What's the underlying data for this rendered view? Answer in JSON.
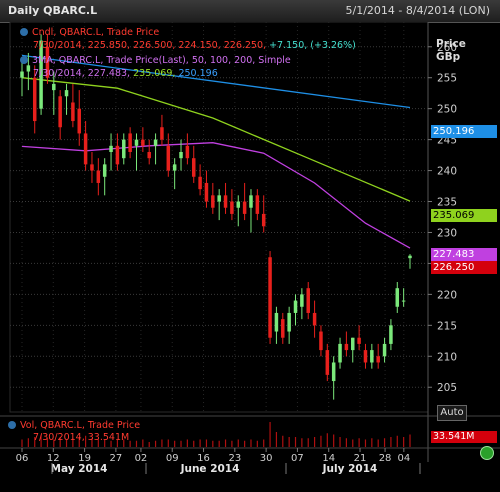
{
  "window": {
    "title": "Daily QBARC.L",
    "date_range": "5/1/2014 - 8/4/2014 (LON)"
  },
  "legends": {
    "price_line1": "Cndl, QBARC.L, Trade Price",
    "price_line2_date": "7/30/2014,",
    "price_line2_ohlc": "225.850, 226.500, 224.150, 226.250,",
    "price_line2_change": "+7.150, (+3.26%)",
    "ma_line1": "3MA, QBARC.L, Trade Price(Last), 50, 100, 200, Simple",
    "ma_line2_date": "7/30/2014,",
    "ma_val1": "227.483,",
    "ma_val2": "235.069,",
    "ma_val3": "250.196",
    "vol_line1": "Vol, QBARC.L, Trade Price",
    "vol_line2": "7/30/2014, 33.541M"
  },
  "price_axis": {
    "title_line1": "Price",
    "title_line2": "GBp"
  },
  "tags": {
    "ma200": "250.196",
    "ma100": "235.069",
    "ma50": "227.483",
    "last": "226.250"
  },
  "auto_button": "Auto",
  "volume_tag": "33.541M",
  "colors": {
    "up": "#7be87b",
    "down": "#e8201c",
    "ma50": "#c040e0",
    "ma100": "#8fd21e",
    "ma200": "#1e8fe6",
    "last_tag": "#d4000c"
  },
  "chart_data": {
    "type": "candlestick",
    "ylim": [
      201,
      264
    ],
    "yticks": [
      205,
      210,
      215,
      220,
      225,
      230,
      235,
      240,
      245,
      250,
      255,
      260
    ],
    "x_day_labels": [
      "06",
      "12",
      "19",
      "27",
      "02",
      "09",
      "16",
      "23",
      "30",
      "07",
      "14",
      "21",
      "28",
      "04"
    ],
    "x_month_labels": [
      "May 2014",
      "June 2014",
      "July 2014"
    ],
    "ohlc": [
      [
        255,
        258,
        252,
        256
      ],
      [
        256,
        259,
        253,
        257
      ],
      [
        255,
        257,
        246,
        248
      ],
      [
        250,
        262,
        249,
        261
      ],
      [
        260,
        262,
        254,
        255
      ],
      [
        253,
        256,
        249,
        254
      ],
      [
        252,
        253,
        245,
        247
      ],
      [
        252,
        254,
        249,
        253
      ],
      [
        251,
        254,
        247,
        248
      ],
      [
        250,
        253,
        244,
        246
      ],
      [
        246,
        248,
        240,
        241
      ],
      [
        241,
        243,
        238,
        240
      ],
      [
        240,
        242,
        236,
        238
      ],
      [
        239,
        242,
        236,
        241
      ],
      [
        243,
        246,
        240,
        244
      ],
      [
        244,
        246,
        240,
        241
      ],
      [
        242,
        246,
        241,
        245
      ],
      [
        246,
        247,
        242,
        243
      ],
      [
        244,
        246,
        240,
        245
      ],
      [
        245,
        247,
        243,
        244
      ],
      [
        243,
        245,
        241,
        242
      ],
      [
        244,
        246,
        241,
        245
      ],
      [
        247,
        249,
        244,
        245
      ],
      [
        244,
        246,
        239,
        240
      ],
      [
        240,
        242,
        237,
        241
      ],
      [
        242,
        245,
        240,
        243
      ],
      [
        244,
        246,
        241,
        242
      ],
      [
        242,
        244,
        238,
        239
      ],
      [
        239,
        241,
        236,
        237
      ],
      [
        238,
        240,
        234,
        235
      ],
      [
        236,
        238,
        233,
        234
      ],
      [
        235,
        237,
        232,
        236
      ],
      [
        236,
        238,
        233,
        234
      ],
      [
        235,
        237,
        232,
        233
      ],
      [
        234,
        236,
        231,
        235
      ],
      [
        235,
        238,
        232,
        233
      ],
      [
        234,
        237,
        230,
        236
      ],
      [
        236,
        237,
        232,
        233
      ],
      [
        233,
        236,
        230,
        231
      ],
      [
        226,
        227,
        212,
        213
      ],
      [
        214,
        218,
        212,
        217
      ],
      [
        216,
        217,
        212,
        213
      ],
      [
        214,
        218,
        212,
        217
      ],
      [
        217,
        220,
        215,
        219
      ],
      [
        218,
        221,
        216,
        220
      ],
      [
        221,
        222,
        216,
        217
      ],
      [
        217,
        219,
        213,
        215
      ],
      [
        214,
        215,
        210,
        211
      ],
      [
        211,
        212,
        206,
        207
      ],
      [
        206,
        210,
        203,
        209
      ],
      [
        209,
        213,
        208,
        212
      ],
      [
        212,
        214,
        210,
        211
      ],
      [
        211,
        213,
        209,
        213
      ],
      [
        213,
        215,
        211,
        212
      ],
      [
        211,
        212,
        208,
        209
      ],
      [
        209,
        212,
        208,
        211
      ],
      [
        210,
        212,
        208,
        209
      ],
      [
        210,
        213,
        209,
        212
      ],
      [
        212,
        216,
        211,
        215
      ],
      [
        218,
        222,
        217,
        221
      ],
      [
        219,
        221,
        218,
        219
      ],
      [
        225.85,
        226.5,
        224.15,
        226.25
      ]
    ],
    "volume_relative": [
      0.3,
      0.35,
      0.4,
      0.5,
      0.35,
      0.3,
      0.4,
      0.3,
      0.35,
      0.4,
      0.45,
      0.35,
      0.3,
      0.3,
      0.25,
      0.3,
      0.3,
      0.25,
      0.25,
      0.3,
      0.2,
      0.25,
      0.3,
      0.3,
      0.25,
      0.25,
      0.3,
      0.25,
      0.3,
      0.3,
      0.25,
      0.25,
      0.3,
      0.25,
      0.3,
      0.25,
      0.3,
      0.25,
      0.3,
      1.0,
      0.6,
      0.45,
      0.4,
      0.4,
      0.35,
      0.35,
      0.4,
      0.45,
      0.55,
      0.5,
      0.4,
      0.35,
      0.3,
      0.35,
      0.3,
      0.35,
      0.3,
      0.35,
      0.4,
      0.45,
      0.4,
      0.5
    ],
    "ma200": [
      [
        0,
        258.6
      ],
      [
        61,
        250.196
      ]
    ],
    "ma100": [
      [
        0,
        255.0
      ],
      [
        15,
        253.3
      ],
      [
        30,
        248.5
      ],
      [
        45,
        242.0
      ],
      [
        61,
        235.069
      ]
    ],
    "ma50": [
      [
        0,
        243.9
      ],
      [
        10,
        243.2
      ],
      [
        20,
        244.0
      ],
      [
        30,
        244.5
      ],
      [
        38,
        242.8
      ],
      [
        46,
        238.0
      ],
      [
        54,
        231.5
      ],
      [
        61,
        227.483
      ]
    ]
  }
}
